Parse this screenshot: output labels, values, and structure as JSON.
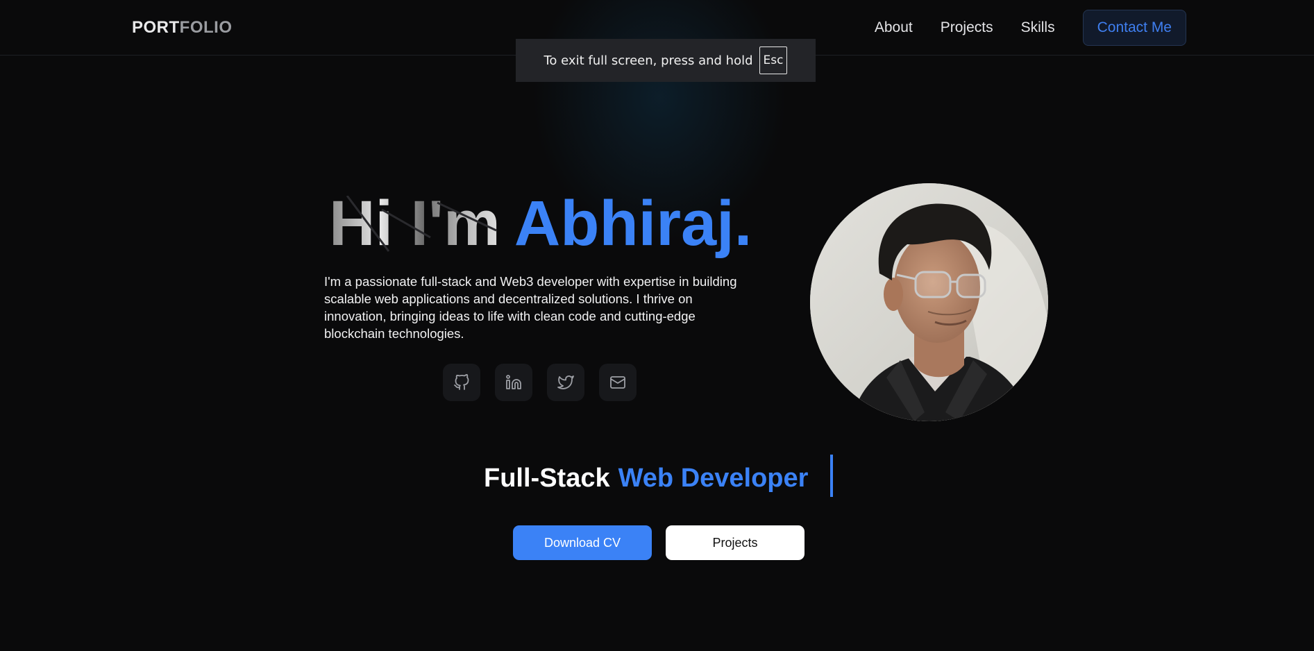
{
  "header": {
    "logo_part1": "PORT",
    "logo_part2": "FOLIO",
    "nav": [
      "About",
      "Projects",
      "Skills"
    ],
    "contact_label": "Contact Me"
  },
  "fullscreen_notice": {
    "text": "To exit full screen, press and hold",
    "key": "Esc"
  },
  "hero": {
    "greeting": "Hi I'm",
    "name": "Abhiraj.",
    "description": "I'm a passionate full-stack and Web3 developer with expertise in building scalable web applications and decentralized solutions. I thrive on innovation, bringing ideas to life with clean code and cutting-edge blockchain technologies.",
    "socials": [
      {
        "icon": "github-icon"
      },
      {
        "icon": "linkedin-icon"
      },
      {
        "icon": "twitter-icon"
      },
      {
        "icon": "mail-icon"
      }
    ],
    "role_part1": "Full-Stack",
    "role_part2": "Web Developer",
    "download_label": "Download CV",
    "projects_label": "Projects"
  },
  "colors": {
    "accent": "#3b82f6",
    "background": "#0a0a0b"
  }
}
